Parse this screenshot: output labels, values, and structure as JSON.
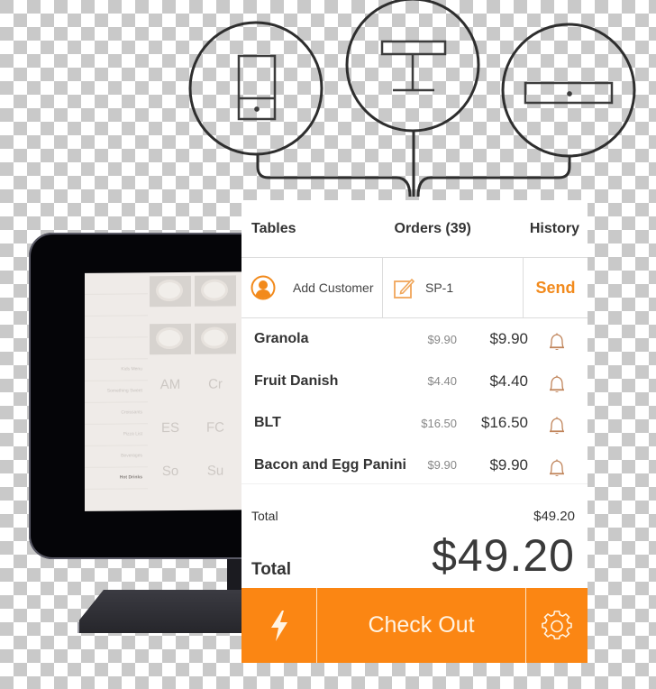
{
  "diagram": {
    "icons": [
      "tablet-stand-icon",
      "table-terminal-icon",
      "cash-drawer-icon"
    ]
  },
  "monitor_screen": {
    "categories": [
      "",
      "",
      "",
      "",
      "Kids Menu",
      "Something Sweet",
      "Croissants",
      "Pizza List",
      "Beverages",
      "Hot Drinks"
    ],
    "active_category": "Hot Drinks",
    "tiles": [
      {
        "abbr": "AM",
        "name": ""
      },
      {
        "abbr": "Cr",
        "name": ""
      },
      {
        "abbr": "ES",
        "name": ""
      },
      {
        "abbr": "FC",
        "name": ""
      },
      {
        "abbr": "So",
        "name": ""
      },
      {
        "abbr": "Su",
        "name": ""
      }
    ]
  },
  "pos": {
    "nav": {
      "tables": "Tables",
      "orders": "Orders (39)",
      "history": "History"
    },
    "actions": {
      "add_customer": "Add Customer",
      "order_ref": "SP-1",
      "send": "Send"
    },
    "items": [
      {
        "name": "Granola",
        "unit_price": "$9.90",
        "total": "$9.90"
      },
      {
        "name": "Fruit Danish",
        "unit_price": "$4.40",
        "total": "$4.40"
      },
      {
        "name": "BLT",
        "unit_price": "$16.50",
        "total": "$16.50"
      },
      {
        "name": "Bacon and Egg Panini",
        "unit_price": "$9.90",
        "total": "$9.90"
      }
    ],
    "totals": {
      "subtotal_label": "Total",
      "subtotal_value": "$49.20",
      "total_label": "Total",
      "total_value": "$49.20"
    },
    "footer": {
      "checkout": "Check Out"
    },
    "colors": {
      "accent": "#fb8613",
      "send": "#f28a1c",
      "bell": "#c0845a"
    }
  }
}
